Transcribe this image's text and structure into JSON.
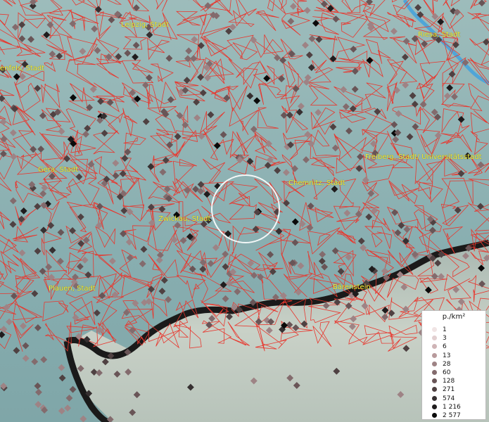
{
  "map": {
    "cities": [
      {
        "name": "Leipzig, Stadt"
      },
      {
        "name": "Riesa, Stadt"
      },
      {
        "name": "enfels, Stadt"
      },
      {
        "name": "Gera, Stadt"
      },
      {
        "name": "Freiberg, Stadt/ Universitätsstadt"
      },
      {
        "name": "Chemnitz, Stadt"
      },
      {
        "name": "Zwickau, Stadt"
      },
      {
        "name": "Plauen, Stadt"
      },
      {
        "name": "Bärenstein"
      }
    ]
  },
  "legend": {
    "unit": "p./km²",
    "items": [
      {
        "label": "1",
        "color": "#f0e4e4"
      },
      {
        "label": "3",
        "color": "#e2cfd0"
      },
      {
        "label": "6",
        "color": "#cfb4b6"
      },
      {
        "label": "13",
        "color": "#b89a9c"
      },
      {
        "label": "28",
        "color": "#9e8385"
      },
      {
        "label": "60",
        "color": "#836b6d"
      },
      {
        "label": "128",
        "color": "#695557"
      },
      {
        "label": "271",
        "color": "#4f4142"
      },
      {
        "label": "574",
        "color": "#363031"
      },
      {
        "label": "1 216",
        "color": "#1f1c1d"
      },
      {
        "label": "2 577",
        "color": "#0a0a0a"
      }
    ]
  }
}
